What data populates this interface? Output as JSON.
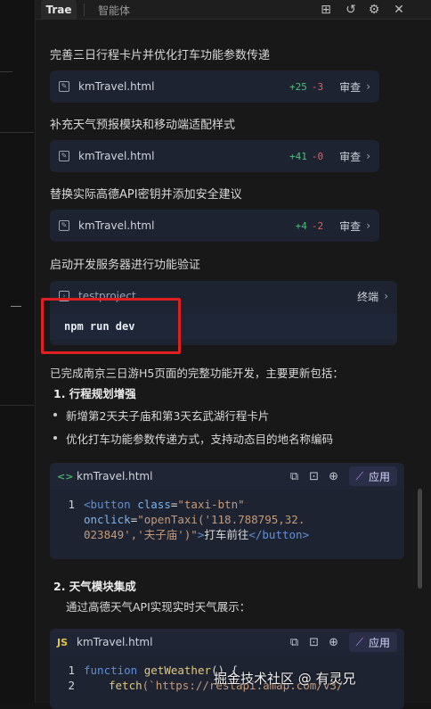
{
  "tabs": {
    "trae": "Trae",
    "agent": "智能体"
  },
  "top_icons": [
    "new-chat-icon",
    "history-icon",
    "settings-icon",
    "close-icon"
  ],
  "top_glyphs": {
    "new_chat": "⊞",
    "history": "↺",
    "settings": "⚙",
    "close": "✕"
  },
  "steps": [
    {
      "title": "完善三日行程卡片并优化打车功能参数传递",
      "file": "kmTravel.html",
      "add": "+25",
      "del": "-3",
      "action": "审查"
    },
    {
      "title": "补充天气预报模块和移动端适配样式",
      "file": "kmTravel.html",
      "add": "+41",
      "del": "-0",
      "action": "审查"
    },
    {
      "title": "替换实际高德API密钥并添加安全建议",
      "file": "kmTravel.html",
      "add": "+4",
      "del": "-2",
      "action": "审查"
    }
  ],
  "terminal": {
    "title": "启动开发服务器进行功能验证",
    "project": "testproject",
    "label": "终端",
    "command": "npm run dev"
  },
  "summary": {
    "intro": "已完成南京三日游H5页面的完整功能开发，主要更新包括：",
    "h1": "1. 行程规划增强",
    "b1": "新增第2天夫子庙和第3天玄武湖行程卡片",
    "b2": "优化打车功能参数传递方式，支持动态目的地名称编码",
    "h2": "2. 天气模块集成",
    "p2": "通过高德天气API实现实时天气展示："
  },
  "code1": {
    "lang": "<>",
    "file": "kmTravel.html",
    "apply": "应用",
    "line_no": "1",
    "l1_tag": "<button",
    "l1_attr": " class",
    "l1_eq": "=",
    "l1_str": "\"taxi-btn\"",
    "l2_attr": "onclick",
    "l2_eq": "=",
    "l2_str": "\"openTaxi('118.788795,32.",
    "l3_str": "023849','夫子庙')\"",
    "l3_gt": ">",
    "l3_text": "打车前往",
    "l3_close": "</button>"
  },
  "code2": {
    "lang": "JS",
    "file": "kmTravel.html",
    "apply": "应用",
    "ln1": "1",
    "ln2": "2",
    "l1_kw": "function",
    "l1_fn": " getWeather",
    "l1_rest": "() {",
    "l2_fn": "fetch",
    "l2_rest": "(`https://restapi.amap.com/v3/"
  },
  "watermark": "掘金技术社区 @ 有灵兄"
}
